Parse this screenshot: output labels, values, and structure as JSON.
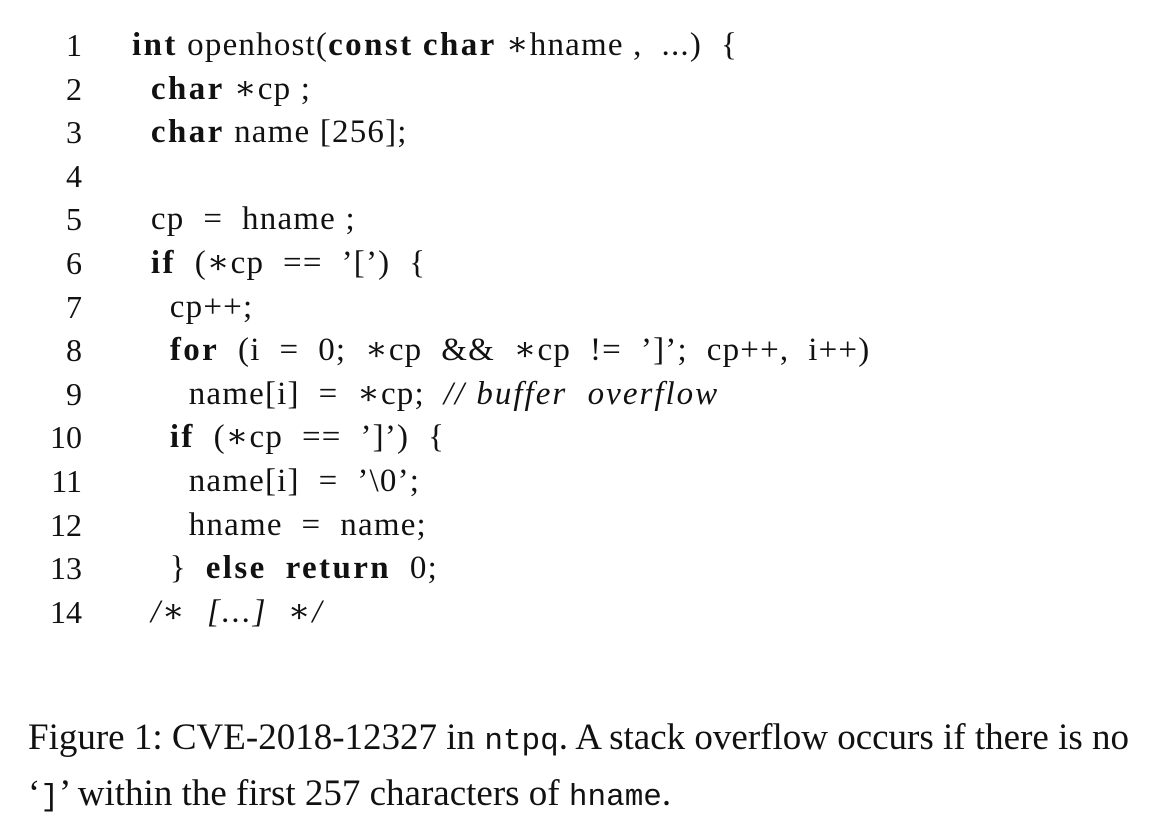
{
  "code": {
    "lines": [
      {
        "number": "1",
        "segments": [
          {
            "t": "int",
            "s": "kw"
          },
          {
            "t": " openhost(",
            "s": ""
          },
          {
            "t": "const",
            "s": "kw"
          },
          {
            "t": " ",
            "s": ""
          },
          {
            "t": "char",
            "s": "kw"
          },
          {
            "t": " ∗hname ,  ...)  {",
            "s": ""
          }
        ]
      },
      {
        "number": "2",
        "segments": [
          {
            "t": "  ",
            "s": ""
          },
          {
            "t": "char",
            "s": "kw"
          },
          {
            "t": " ∗cp ;",
            "s": ""
          }
        ]
      },
      {
        "number": "3",
        "segments": [
          {
            "t": "  ",
            "s": ""
          },
          {
            "t": "char",
            "s": "kw"
          },
          {
            "t": " name [256];",
            "s": ""
          }
        ]
      },
      {
        "number": "4",
        "segments": []
      },
      {
        "number": "5",
        "segments": [
          {
            "t": "  cp  =  hname ;",
            "s": ""
          }
        ]
      },
      {
        "number": "6",
        "segments": [
          {
            "t": "  ",
            "s": ""
          },
          {
            "t": "if",
            "s": "kw"
          },
          {
            "t": "  (∗cp  ==  ’[’)  {",
            "s": ""
          }
        ]
      },
      {
        "number": "7",
        "segments": [
          {
            "t": "    cp++;",
            "s": ""
          }
        ]
      },
      {
        "number": "8",
        "segments": [
          {
            "t": "    ",
            "s": ""
          },
          {
            "t": "for",
            "s": "kw"
          },
          {
            "t": "  (i  =  0;  ∗cp  &&  ∗cp  !=  ’]’;  cp++,  i++)",
            "s": ""
          }
        ]
      },
      {
        "number": "9",
        "segments": [
          {
            "t": "      name[i]  =  ∗cp;  ",
            "s": ""
          },
          {
            "t": "// buffer  overflow",
            "s": "cm"
          }
        ]
      },
      {
        "number": "10",
        "segments": [
          {
            "t": "    ",
            "s": ""
          },
          {
            "t": "if",
            "s": "kw"
          },
          {
            "t": "  (∗cp  ==  ’]’)  {",
            "s": ""
          }
        ]
      },
      {
        "number": "11",
        "segments": [
          {
            "t": "      name[i]  =  ’\\0’;",
            "s": ""
          }
        ]
      },
      {
        "number": "12",
        "segments": [
          {
            "t": "      hname  =  name;",
            "s": ""
          }
        ]
      },
      {
        "number": "13",
        "segments": [
          {
            "t": "    }  ",
            "s": ""
          },
          {
            "t": "else",
            "s": "kw"
          },
          {
            "t": "  ",
            "s": ""
          },
          {
            "t": "return",
            "s": "kw"
          },
          {
            "t": "  0;",
            "s": ""
          }
        ]
      },
      {
        "number": "14",
        "segments": [
          {
            "t": "  ",
            "s": ""
          },
          {
            "t": "/∗  [...]  ∗/",
            "s": "cm"
          }
        ]
      }
    ]
  },
  "caption": {
    "prefix": "Figure 1: CVE-2018-12327 in ",
    "program": "ntpq",
    "middle": ". A stack overflow occurs if there is no ‘",
    "bracket": "]",
    "after_bracket": "’ within the first 257 characters of ",
    "variable": "hname",
    "suffix": "."
  }
}
